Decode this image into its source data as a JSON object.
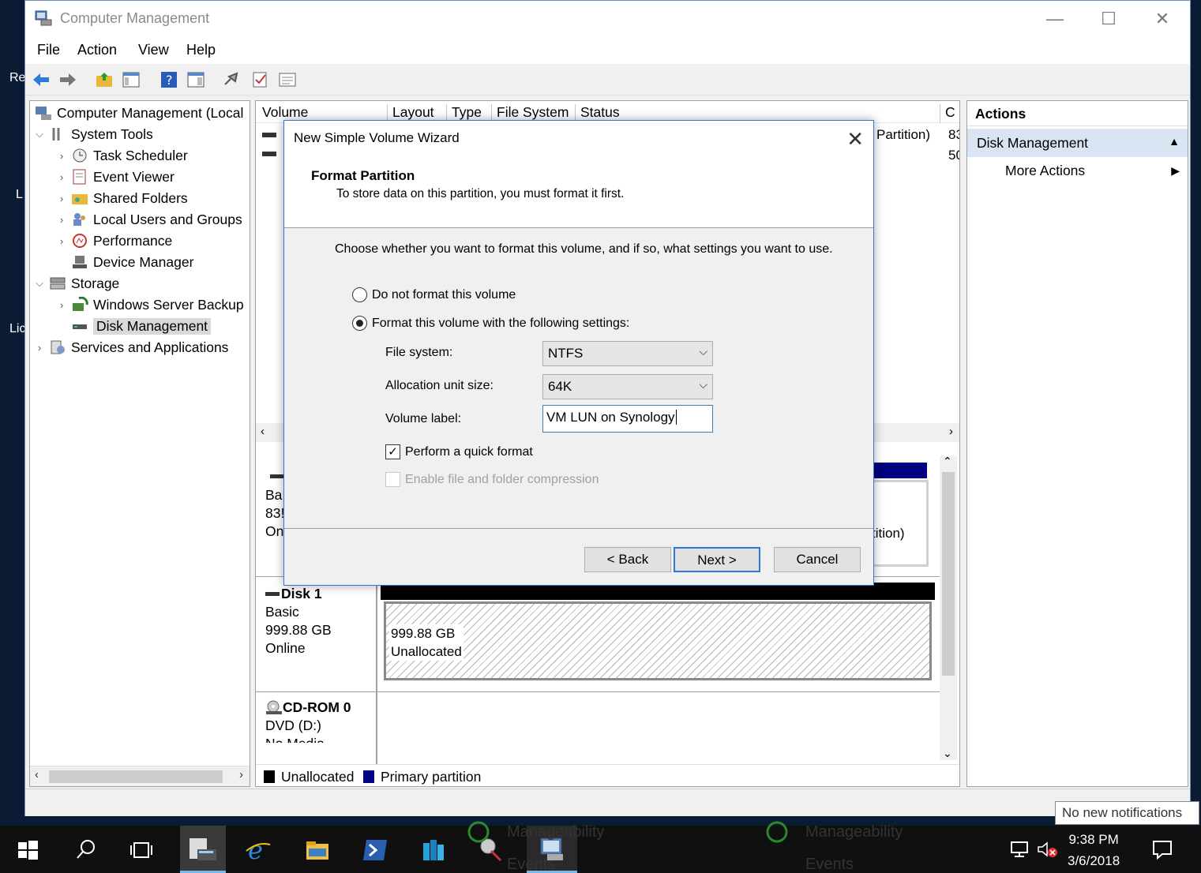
{
  "desktop": {
    "frag1": "Re",
    "frag2": "L",
    "frag3": "Lic"
  },
  "window": {
    "title": "Computer Management",
    "minimize": "—",
    "maximize": "☐",
    "close": "✕"
  },
  "menu": [
    "File",
    "Action",
    "View",
    "Help"
  ],
  "tree": {
    "root": "Computer Management (Local",
    "items": [
      {
        "label": "System Tools"
      },
      {
        "label": "Task Scheduler"
      },
      {
        "label": "Event Viewer"
      },
      {
        "label": "Shared Folders"
      },
      {
        "label": "Local Users and Groups"
      },
      {
        "label": "Performance"
      },
      {
        "label": "Device Manager"
      },
      {
        "label": "Storage"
      },
      {
        "label": "Windows Server Backup"
      },
      {
        "label": "Disk Management"
      },
      {
        "label": "Services and Applications"
      }
    ]
  },
  "volume_table": {
    "headers": [
      "Volume",
      "Layout",
      "Type",
      "File System",
      "Status",
      "C"
    ],
    "partial_status": "Partition)",
    "partial_cap1": "83",
    "partial_cap2": "50"
  },
  "disk_graph": {
    "disk0_partial": [
      "Ba",
      "83!",
      "On"
    ],
    "disk0_right_partial": "tition)",
    "disk1": {
      "name": "Disk 1",
      "type": "Basic",
      "size": "999.88 GB",
      "status": "Online",
      "region_size": "999.88 GB",
      "region_label": "Unallocated"
    },
    "cdrom": {
      "name": "CD-ROM 0",
      "drive": "DVD (D:)",
      "media_partial": "No Media"
    },
    "legend": [
      {
        "label": "Unallocated",
        "color": "#000000"
      },
      {
        "label": "Primary partition",
        "color": "#000080"
      }
    ]
  },
  "actions": {
    "header": "Actions",
    "section": "Disk Management",
    "item": "More Actions"
  },
  "wizard": {
    "title": "New Simple Volume Wizard",
    "heading": "Format Partition",
    "subheading": "To store data on this partition, you must format it first.",
    "intro": "Choose whether you want to format this volume, and if so, what settings you want to use.",
    "radio_no_format": "Do not format this volume",
    "radio_format": "Format this volume with the following settings:",
    "file_system_label": "File system:",
    "file_system_value": "NTFS",
    "alloc_label": "Allocation unit size:",
    "alloc_value": "64K",
    "volume_label_label": "Volume label:",
    "volume_label_value": "VM LUN on Synology",
    "quick_format": "Perform a quick format",
    "compression": "Enable file and folder compression",
    "back": "< Back",
    "next": "Next >",
    "cancel": "Cancel"
  },
  "taskbar": {
    "time": "9:38 PM",
    "date": "3/6/2018",
    "notification": "No new notifications",
    "ghost1": "Manageability",
    "ghost2": "Events",
    "ghost3": "Manageability",
    "ghost4": "Events"
  }
}
